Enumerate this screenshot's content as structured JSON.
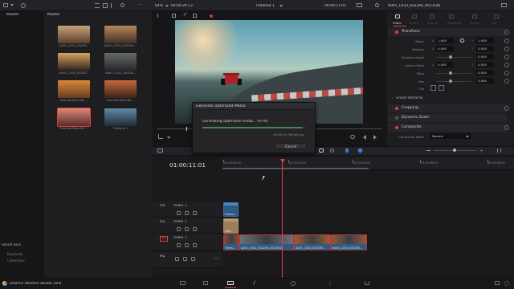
{
  "media_pool": {
    "title": "Master",
    "bin_header": "Master",
    "clips": [
      {
        "label": "A001_C021_0322P...",
        "color_a": "#c9a27a",
        "color_b": "#5b3f2c"
      },
      {
        "label": "A001_C031_0322HU...",
        "color_a": "#b7855a",
        "color_b": "#433023"
      },
      {
        "label": "A001_C033_0322P...",
        "color_a": "#d8a35d",
        "color_b": "#2c2420"
      },
      {
        "label": "A002_C022_0322D...",
        "color_a": "#646b63",
        "color_b": "#24272a"
      },
      {
        "label": "Formula Race 8K ...",
        "color_a": "#d98a35",
        "color_b": "#6a3a22"
      },
      {
        "label": "Formula Race 8K ...",
        "color_a": "#c76a3c",
        "color_b": "#3b2519"
      },
      {
        "label": "Formula Race 8K ...",
        "color_a": "#dd8a7a",
        "color_b": "#5a2a26"
      },
      {
        "label": "Timeline 1",
        "color_a": "#5f8aa3",
        "color_b": "#1f2d38"
      }
    ],
    "smart_bins": "Smart Bins",
    "keywords": "Keywords",
    "collections": "Collections"
  },
  "viewer": {
    "zoom": "64%",
    "timecode_left": "00:00:26:13",
    "timeline_name": "Timeline 1",
    "timecode_right": "00:00:11:01"
  },
  "dialog": {
    "title": "Generate Optimized Media",
    "message": "Generating optimized media... (97%)",
    "progress": 97,
    "remaining": "00:00:01 Remaining",
    "cancel": "Cancel"
  },
  "inspector": {
    "clip_name": "A001_C033_0322PZ_001.R3D",
    "tabs": [
      "Video",
      "Audio",
      "Effects",
      "Transition",
      "Image",
      "File"
    ],
    "transform_label": "Transform",
    "zoom_label": "Zoom",
    "zoom_x": "1.000",
    "zoom_y": "1.000",
    "position_label": "Position",
    "position_x": "0.000",
    "position_y": "0.000",
    "rotation_label": "Rotation Angle",
    "rotation": "0.000",
    "anchor_label": "Anchor Point",
    "anchor_x": "0.000",
    "anchor_y": "0.000",
    "pitch_label": "Pitch",
    "pitch": "0.000",
    "yaw_label": "Yaw",
    "yaw": "0.000",
    "flip_label": "Flip",
    "axis_x": "X",
    "axis_y": "Y",
    "smart_reframe": "Smart Reframe",
    "cropping": "Cropping",
    "dynamic_zoom": "Dynamic Zoom",
    "composite": "Composite",
    "composite_mode_label": "Composite Mode",
    "composite_mode": "Normal"
  },
  "timeline": {
    "timecode": "01:00:11:01",
    "ruler": [
      "01:00:00:00",
      "01:00:12:00",
      "01:00:24:00",
      "01:00:36:00",
      "01:00:48:00"
    ],
    "tracks": [
      {
        "id": "V3",
        "name": "Video 3"
      },
      {
        "id": "V2",
        "name": "Video 2"
      },
      {
        "id": "V1",
        "name": "Video 1"
      },
      {
        "id": "A1",
        "name": ""
      }
    ],
    "clips_v3": "Fusion...",
    "clips_v2": "Text...",
    "clips_v1": [
      "Formu...",
      "A001_C031_0322HU_001.R3D",
      "A001_C033_0322PZ...",
      "A001_C033_0322PZ..."
    ],
    "a1_level": "2.0"
  },
  "footer": {
    "app": "DaVinci Resolve Studio 18.6"
  },
  "colors": {
    "accent_red": "#e0403c",
    "playhead": "#e0403c",
    "clip_blue": "#2d5b86",
    "audio_green": "#3a7a4a"
  }
}
